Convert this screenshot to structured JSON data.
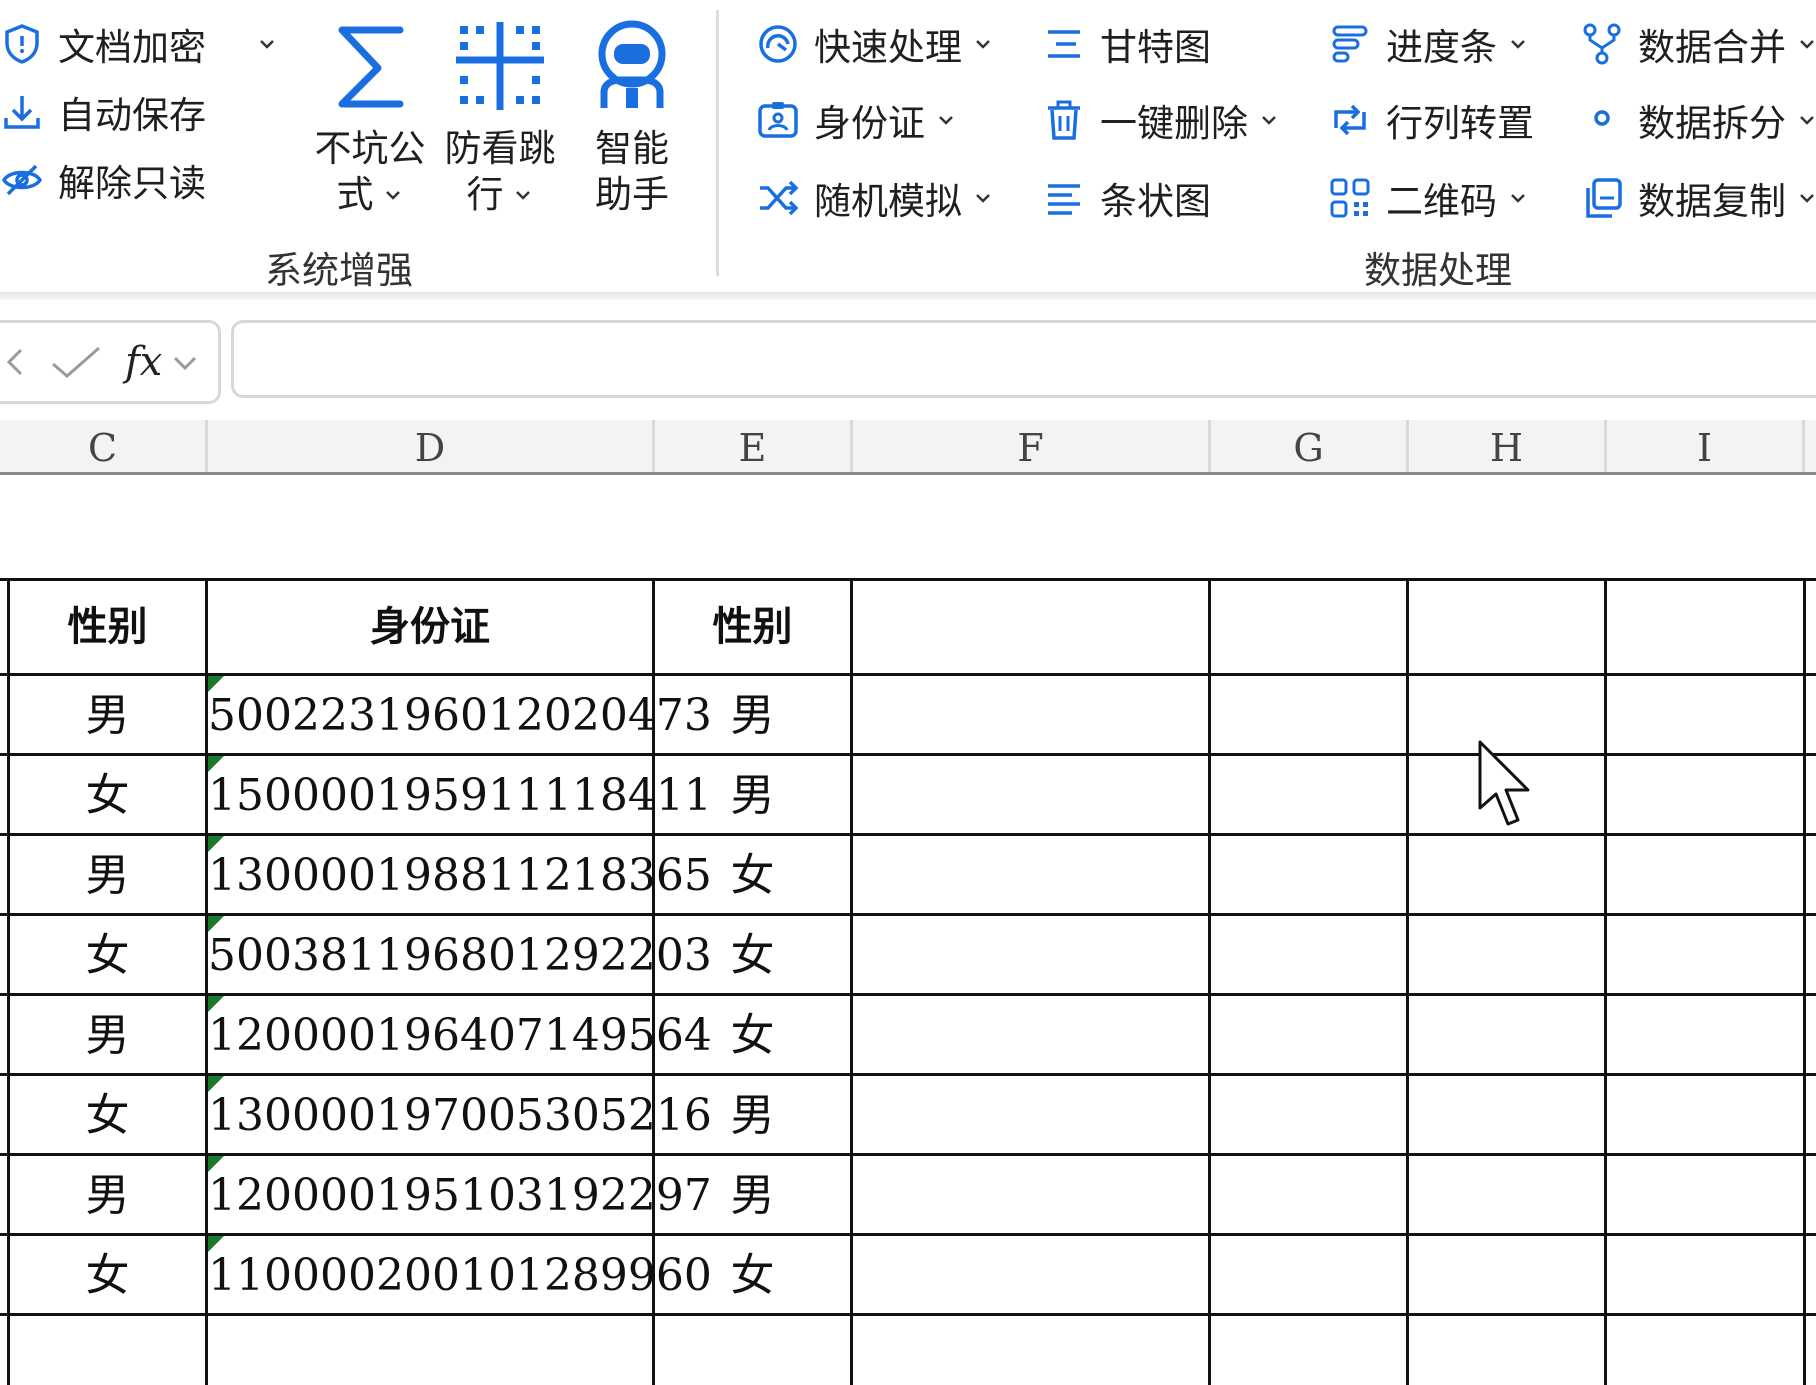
{
  "ribbon": {
    "left_items": [
      {
        "label": "文档加密",
        "icon": "shield-icon",
        "has_dropdown": true
      },
      {
        "label": "自动保存",
        "icon": "download-save-icon",
        "has_dropdown": false
      },
      {
        "label": "解除只读",
        "icon": "eye-slash-icon",
        "has_dropdown": false
      }
    ],
    "big_buttons": [
      {
        "line1": "不坑公",
        "line2": "式",
        "icon": "sigma-icon",
        "has_dropdown": true
      },
      {
        "line1": "防看跳",
        "line2": "行",
        "icon": "crosshair-grid-icon",
        "has_dropdown": true
      },
      {
        "line1": "智能",
        "line2": "助手",
        "icon": "robot-assistant-icon",
        "has_dropdown": false
      }
    ],
    "group_system_label": "系统增强",
    "data_items": [
      {
        "label": "快速处理",
        "icon": "speed-icon",
        "has_dropdown": true
      },
      {
        "label": "身份证",
        "icon": "id-card-icon",
        "has_dropdown": true
      },
      {
        "label": "随机模拟",
        "icon": "shuffle-icon",
        "has_dropdown": true
      },
      {
        "label": "甘特图",
        "icon": "gantt-icon",
        "has_dropdown": false
      },
      {
        "label": "一键删除",
        "icon": "trash-icon",
        "has_dropdown": true
      },
      {
        "label": "条状图",
        "icon": "bar-lines-icon",
        "has_dropdown": false
      },
      {
        "label": "进度条",
        "icon": "progress-bar-icon",
        "has_dropdown": true
      },
      {
        "label": "行列转置",
        "icon": "transpose-icon",
        "has_dropdown": false
      },
      {
        "label": "二维码",
        "icon": "qr-code-icon",
        "has_dropdown": true
      },
      {
        "label": "数据合并",
        "icon": "merge-icon",
        "has_dropdown": true
      },
      {
        "label": "数据拆分",
        "icon": "split-icon",
        "has_dropdown": true
      },
      {
        "label": "数据复制",
        "icon": "copy-icon",
        "has_dropdown": true
      }
    ],
    "group_data_label": "数据处理"
  },
  "formula_bar": {
    "fx_label": "fx",
    "value": ""
  },
  "columns": [
    "C",
    "D",
    "E",
    "F",
    "G",
    "H",
    "I"
  ],
  "table": {
    "headers": [
      "性别",
      "身份证",
      "性别"
    ],
    "rows": [
      [
        "男",
        "500223196012020473",
        "男"
      ],
      [
        "女",
        "150000195911118411",
        "男"
      ],
      [
        "男",
        "130000198811218365",
        "女"
      ],
      [
        "女",
        "500381196801292203",
        "女"
      ],
      [
        "男",
        "120000196407149564",
        "女"
      ],
      [
        "女",
        "130000197005305216",
        "男"
      ],
      [
        "男",
        "120000195103192297",
        "男"
      ],
      [
        "女",
        "110000200101289960",
        "女"
      ]
    ]
  },
  "colors": {
    "accent_blue": "#1a6fe0",
    "grid_line": "#111111",
    "number_as_text_marker": "#1a7a2a"
  }
}
